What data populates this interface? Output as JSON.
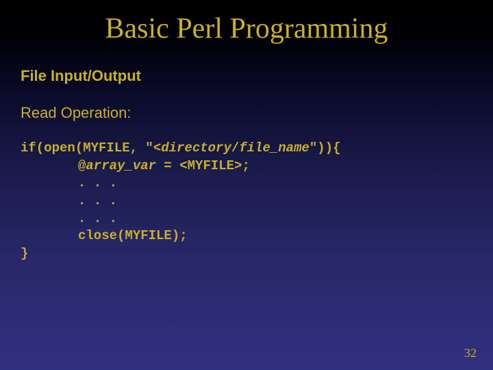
{
  "title": "Basic Perl Programming",
  "subtitle": "File Input/Output",
  "subhead": "Read Operation:",
  "code": {
    "l1a": "if(open(MYFILE, \"<",
    "l1b": "directory",
    "l1c": "/",
    "l1d": "file_name",
    "l1e": "\")){",
    "l2a": "@",
    "l2b": "array_var",
    "l2c": " = <MYFILE>;",
    "l3": ". . .",
    "l4": ". . .",
    "l5": ". . .",
    "l6": "close(MYFILE);",
    "l7": "}"
  },
  "page_number": "32"
}
